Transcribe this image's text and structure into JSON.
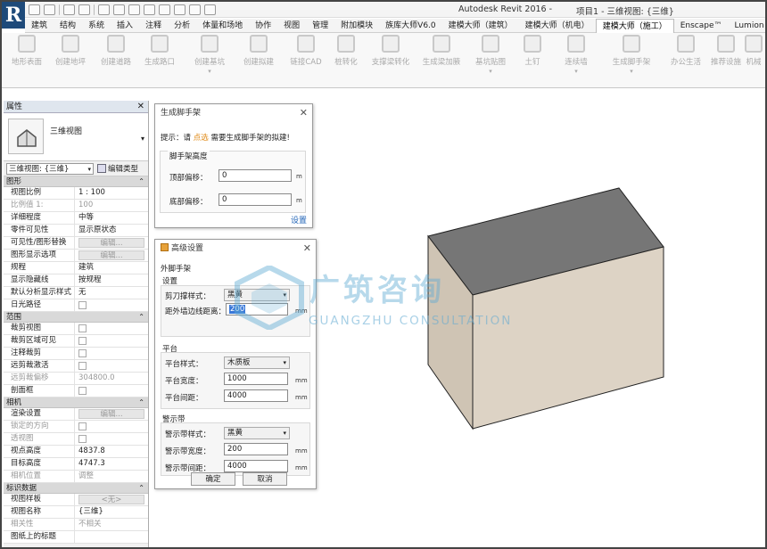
{
  "app_title": "Autodesk Revit 2016 -",
  "doc_title": "项目1 - 三维视图: {三维}",
  "tabs": [
    "建筑",
    "结构",
    "系统",
    "插入",
    "注释",
    "分析",
    "体量和场地",
    "协作",
    "视图",
    "管理",
    "附加模块",
    "族库大师V6.0",
    "建模大师（建筑）",
    "建模大师（机电）",
    "建模大师（施工）",
    "Enscape™",
    "Lumion"
  ],
  "active_tab": "建模大师（施工）",
  "ribbon": [
    "地形表面",
    "创建地坪",
    "创建道路",
    "生成路口",
    "创建基坑",
    "创建拟建",
    "链接CAD",
    "桩转化",
    "支撑梁转化",
    "生成梁加腋",
    "基坑贴图",
    "土钉",
    "连续墙",
    "生成脚手架",
    "办公生活",
    "推荐设施",
    "机械"
  ],
  "properties": {
    "header": "属性",
    "close": "✕",
    "type_name": "三维视图",
    "selector": "三维视图: {三维}",
    "edit_type": "编辑类型",
    "groups": [
      {
        "title": "图形",
        "rows": [
          {
            "k": "视图比例",
            "v": "1 : 100"
          },
          {
            "k": "比例值 1:",
            "v": "100",
            "gray": true
          },
          {
            "k": "详细程度",
            "v": "中等"
          },
          {
            "k": "零件可见性",
            "v": "显示原状态"
          },
          {
            "k": "可见性/图形替换",
            "v": "编辑...",
            "btn": true
          },
          {
            "k": "图形显示选项",
            "v": "编辑...",
            "btn": true
          },
          {
            "k": "规程",
            "v": "建筑"
          },
          {
            "k": "显示隐藏线",
            "v": "按规程"
          },
          {
            "k": "默认分析显示样式",
            "v": "无"
          },
          {
            "k": "日光路径",
            "v": "",
            "chk": true
          }
        ]
      },
      {
        "title": "范围",
        "rows": [
          {
            "k": "裁剪视图",
            "v": "",
            "chk": true
          },
          {
            "k": "裁剪区域可见",
            "v": "",
            "chk": true
          },
          {
            "k": "注释裁剪",
            "v": "",
            "chk": true
          },
          {
            "k": "远剪裁激活",
            "v": "",
            "chk": true
          },
          {
            "k": "远剪裁偏移",
            "v": "304800.0",
            "gray": true
          },
          {
            "k": "剖面框",
            "v": "",
            "chk": true
          }
        ]
      },
      {
        "title": "相机",
        "rows": [
          {
            "k": "渲染设置",
            "v": "编辑...",
            "btn": true
          },
          {
            "k": "锁定的方向",
            "v": "",
            "chk": true,
            "gray": true
          },
          {
            "k": "透视图",
            "v": "",
            "chk": true,
            "gray": true
          },
          {
            "k": "视点高度",
            "v": "4837.8"
          },
          {
            "k": "目标高度",
            "v": "4747.3"
          },
          {
            "k": "相机位置",
            "v": "调整",
            "gray": true
          }
        ]
      },
      {
        "title": "标识数据",
        "rows": [
          {
            "k": "视图样板",
            "v": "<无>",
            "btn": true
          },
          {
            "k": "视图名称",
            "v": "{三维}"
          },
          {
            "k": "相关性",
            "v": "不相关",
            "gray": true
          },
          {
            "k": "图纸上的标题",
            "v": ""
          }
        ]
      }
    ]
  },
  "dialog1": {
    "title": "生成脚手架",
    "hint_prefix": "提示：请",
    "hint_link": "点选",
    "hint_suffix": "需要生成脚手架的拟建!",
    "group": "脚手架高度",
    "top_label": "顶部偏移：",
    "top_value": "0",
    "bottom_label": "底部偏移：",
    "bottom_value": "0",
    "unit": "m",
    "settings_link": "设置"
  },
  "dialog2": {
    "title": "高级设置",
    "section": "外脚手架",
    "settings_group": "设置",
    "brace_label": "剪刀撑样式：",
    "brace_value": "黑黄",
    "dist_label": "距外墙边线距离：",
    "dist_value": "200",
    "platform_group": "平台",
    "platform_style_label": "平台样式：",
    "platform_style_value": "木质板",
    "platform_width_label": "平台宽度：",
    "platform_width_value": "1000",
    "platform_spacing_label": "平台间距：",
    "platform_spacing_value": "4000",
    "warn_group": "警示带",
    "warn_style_label": "警示带样式：",
    "warn_style_value": "黑黄",
    "warn_width_label": "警示带宽度：",
    "warn_width_value": "200",
    "warn_spacing_label": "警示带间距：",
    "warn_spacing_value": "4000",
    "unit": "mm",
    "ok": "确定",
    "cancel": "取消"
  },
  "watermark": {
    "cn": "广筑咨询",
    "en": "GUANGZHU CONSULTATION"
  }
}
